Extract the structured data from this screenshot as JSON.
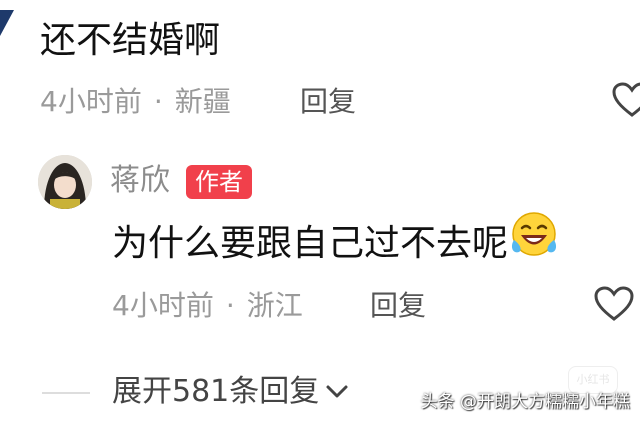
{
  "top_comment": {
    "text": "还不结婚啊",
    "time": "4小时前",
    "separator": "·",
    "location": "新疆",
    "reply_label": "回复"
  },
  "author_reply": {
    "username": "蒋欣",
    "badge": "作者",
    "text": "为什么要跟自己过不去呢",
    "emoji": "laughing-crying-emoji",
    "time": "4小时前",
    "separator": "·",
    "location": "浙江",
    "reply_label": "回复"
  },
  "expand": {
    "label": "展开581条回复"
  },
  "ghost_watermark": "小红书",
  "watermark": "头条 @开朗大方糯糯小年糕",
  "icons": {
    "like": "heart-outline-icon",
    "expand": "chevron-down-icon"
  },
  "colors": {
    "badge": "#f1404b",
    "meta_text": "#9a9a9a",
    "corner_mark": "#1e3a6b"
  }
}
